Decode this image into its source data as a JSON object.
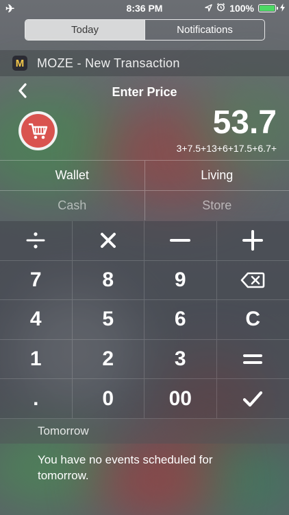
{
  "status_bar": {
    "time": "8:36 PM",
    "battery_text": "100%",
    "battery_level": 1.0,
    "battery_color": "#4cd964",
    "icons": [
      "airplane-icon",
      "location-icon",
      "alarm-icon",
      "battery-icon",
      "charging-icon"
    ]
  },
  "segments": [
    {
      "label": "Today",
      "active": true
    },
    {
      "label": "Notifications",
      "active": false
    }
  ],
  "widget": {
    "app_icon_letter": "M",
    "title": "MOZE - New Transaction"
  },
  "transaction": {
    "nav_title": "Enter Price",
    "back_icon": "chevron-left-icon",
    "category_icon": "shopping-cart-icon",
    "category_color": "#d9534f",
    "amount": "53.7",
    "expression": "3+7.5+13+6+17.5+6.7+",
    "account": "Wallet",
    "category": "Living",
    "account_sub": "Cash",
    "category_sub": "Store"
  },
  "keypad": {
    "keys": [
      {
        "label": "÷",
        "name": "divide-key"
      },
      {
        "label": "✕",
        "name": "multiply-key"
      },
      {
        "label": "—",
        "name": "minus-key"
      },
      {
        "label": "+",
        "name": "plus-key"
      },
      {
        "label": "7",
        "name": "key-7"
      },
      {
        "label": "8",
        "name": "key-8"
      },
      {
        "label": "9",
        "name": "key-9"
      },
      {
        "label": "",
        "name": "backspace-key"
      },
      {
        "label": "4",
        "name": "key-4"
      },
      {
        "label": "5",
        "name": "key-5"
      },
      {
        "label": "6",
        "name": "key-6"
      },
      {
        "label": "C",
        "name": "clear-key"
      },
      {
        "label": "1",
        "name": "key-1"
      },
      {
        "label": "2",
        "name": "key-2"
      },
      {
        "label": "3",
        "name": "key-3"
      },
      {
        "label": "=",
        "name": "equals-key"
      },
      {
        "label": ".",
        "name": "decimal-key"
      },
      {
        "label": "0",
        "name": "key-0"
      },
      {
        "label": "00",
        "name": "key-00"
      },
      {
        "label": "✔",
        "name": "confirm-key"
      }
    ]
  },
  "calendar": {
    "header": "Tomorrow",
    "message": "You have no events scheduled for tomorrow."
  }
}
